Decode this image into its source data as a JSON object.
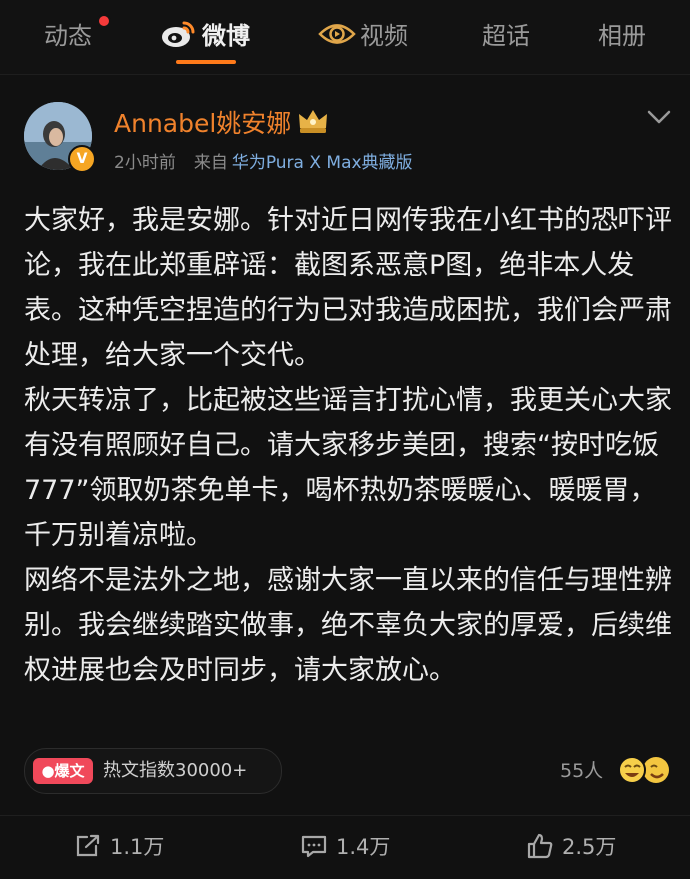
{
  "nav": {
    "tabs": [
      {
        "label": "动态"
      },
      {
        "label": "微博"
      },
      {
        "label": "视频"
      },
      {
        "label": "超话"
      },
      {
        "label": "相册"
      }
    ],
    "active_tab": "微博"
  },
  "post": {
    "username": "Annabel姚安娜",
    "time": "2小时前",
    "from_label": "来自",
    "device": "华为Pura X Max典藏版",
    "paragraphs": [
      "大家好，我是安娜。针对近日网传我在小红书的恐吓评论，我在此郑重辟谣：截图系恶意P图，绝非本人发表。这种凭空捏造的行为已对我造成困扰，我们会严肃处理，给大家一个交代。",
      "秋天转凉了，比起被这些谣言打扰心情，我更关心大家有没有照顾好自己。请大家移步美团，搜索“按时吃饭777”领取奶茶免单卡，喝杯热奶茶暖暖心、暖暖胃，千万别着凉啦。",
      "网络不是法外之地，感谢大家一直以来的信任与理性辨别。我会继续踏实做事，绝不辜负大家的厚爱，后续维权进展也会及时同步，请大家放心。"
    ],
    "hot_tag": "爆文",
    "hot_text": "热文指数30000+",
    "likers": "55人"
  },
  "actions": {
    "repost": "1.1万",
    "comment": "1.4万",
    "like": "2.5万"
  },
  "colors": {
    "background": "#111111",
    "accent_orange": "#ff7a1a",
    "username": "#f0822c",
    "device_link": "#7faee0",
    "hot_tag": "#f0495a"
  },
  "icons": [
    "weibo-logo-icon",
    "video-logo-icon",
    "crown-badge-icon",
    "chevron-down-icon",
    "repost-icon",
    "comment-icon",
    "like-icon"
  ]
}
